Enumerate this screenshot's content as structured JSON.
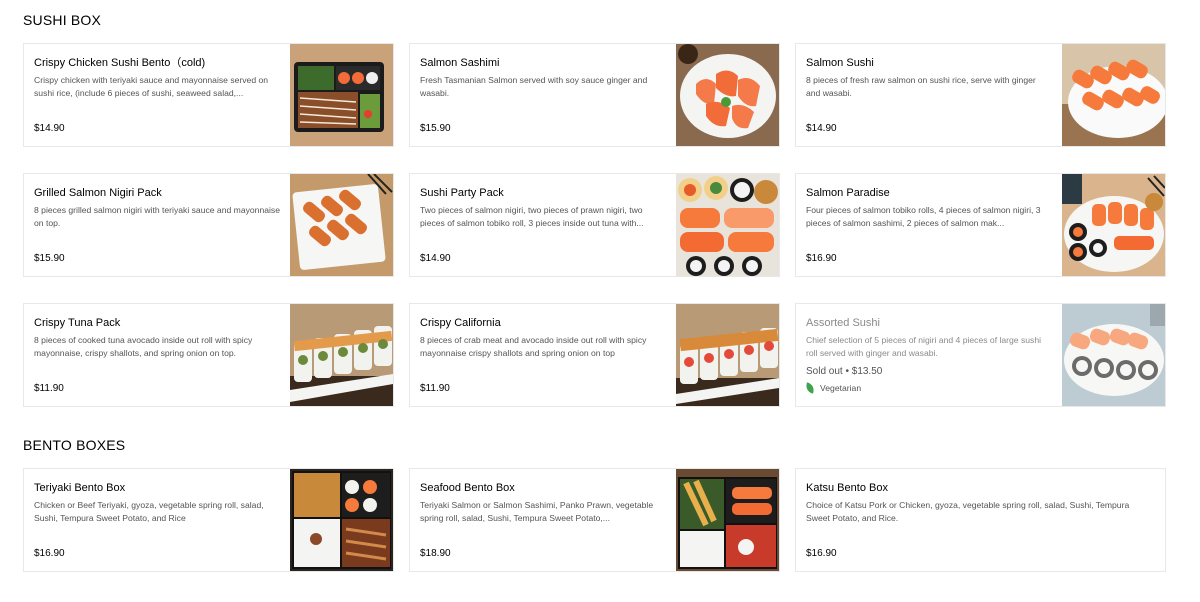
{
  "sections": [
    {
      "title": "SUSHI BOX",
      "items": [
        {
          "name": "Crispy Chicken Sushi Bento（cold)",
          "desc": "Crispy chicken with teriyaki sauce and mayonnaise served on sushi rice, (include 6 pieces of sushi, seaweed salad,...",
          "price": "$14.90"
        },
        {
          "name": "Salmon Sashimi",
          "desc": "Fresh Tasmanian Salmon served with soy sauce ginger and wasabi.",
          "price": "$15.90"
        },
        {
          "name": "Salmon Sushi",
          "desc": "8 pieces of fresh raw salmon on sushi rice, serve with ginger and wasabi.",
          "price": "$14.90"
        },
        {
          "name": "Grilled Salmon Nigiri Pack",
          "desc": "8 pieces grilled salmon nigiri with teriyaki sauce and mayonnaise on top.",
          "price": "$15.90"
        },
        {
          "name": "Sushi Party Pack",
          "desc": "Two pieces of salmon nigiri, two pieces of prawn nigiri, two pieces of salmon tobiko roll, 3 pieces inside out tuna with...",
          "price": "$14.90"
        },
        {
          "name": "Salmon Paradise",
          "desc": "Four pieces of salmon tobiko rolls, 4 pieces of salmon nigiri, 3 pieces of salmon sashimi, 2 pieces of salmon mak...",
          "price": "$16.90"
        },
        {
          "name": "Crispy Tuna Pack",
          "desc": "8 pieces of cooked tuna avocado inside out roll with spicy mayonnaise, crispy shallots, and spring onion on top.",
          "price": "$11.90"
        },
        {
          "name": "Crispy California",
          "desc": "8 pieces of crab meat and avocado inside out roll with spicy mayonnaise crispy shallots and spring onion on top",
          "price": "$11.90"
        },
        {
          "name": "Assorted Sushi",
          "desc": "Chief selection of 5 pieces of nigiri and 4 pieces of large sushi roll served with ginger and wasabi.",
          "price": "",
          "sold_out": "Sold out • $13.50",
          "tag": "Vegetarian"
        }
      ]
    },
    {
      "title": "BENTO BOXES",
      "items": [
        {
          "name": "Teriyaki Bento Box",
          "desc": "Chicken or Beef Teriyaki, gyoza, vegetable spring roll, salad, Sushi, Tempura Sweet Potato, and Rice",
          "price": "$16.90"
        },
        {
          "name": "Seafood Bento Box",
          "desc": "Teriyaki Salmon or Salmon Sashimi, Panko Prawn, vegetable spring roll, salad, Sushi, Tempura Sweet Potato,...",
          "price": "$18.90"
        },
        {
          "name": "Katsu Bento Box",
          "desc": "Choice of Katsu Pork or Chicken, gyoza, vegetable spring roll, salad, Sushi, Tempura Sweet Potato, and Rice.",
          "price": "$16.90"
        }
      ]
    }
  ]
}
